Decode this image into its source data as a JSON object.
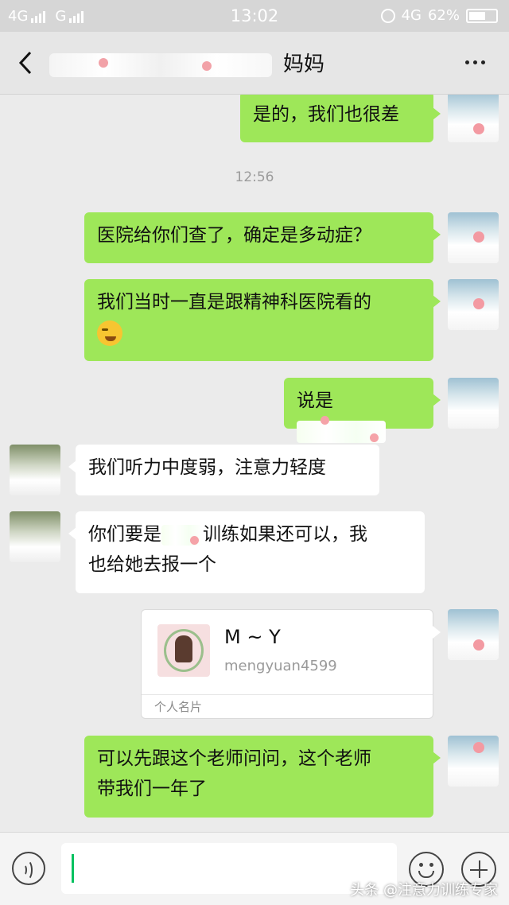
{
  "status": {
    "sig1": "4G",
    "sig2": "G",
    "time": "13:02",
    "net": "4G",
    "battery": "62%",
    "battery_level": 0.62
  },
  "header": {
    "title": "妈妈"
  },
  "chat": {
    "m0": "是的，我们也很差",
    "time": "12:56",
    "m1": "医院给你们查了，确定是多动症？",
    "m2": "我们当时一直是跟精神科医院看的",
    "m3": "说是",
    "m4": "我们听力中度弱，注意力轻度",
    "m5a": "你们要是",
    "m5b": "训练如果还可以，我",
    "m5c": "也给她去报一个",
    "card": {
      "name": "M ~ Y",
      "account": "mengyuan4599",
      "type": "个人名片"
    },
    "m6a": "可以先跟这个老师问问，这个老师",
    "m6b": "带我们一年了"
  },
  "watermark": "头条 @注意力训练专家",
  "icons": [
    "back-icon",
    "more-icon",
    "voice-icon",
    "emoji-icon",
    "plus-icon",
    "alarm-icon",
    "battery-icon"
  ],
  "colors": {
    "bubble_me": "#9ee759",
    "bubble_them": "#ffffff",
    "background": "#ebebeb"
  }
}
